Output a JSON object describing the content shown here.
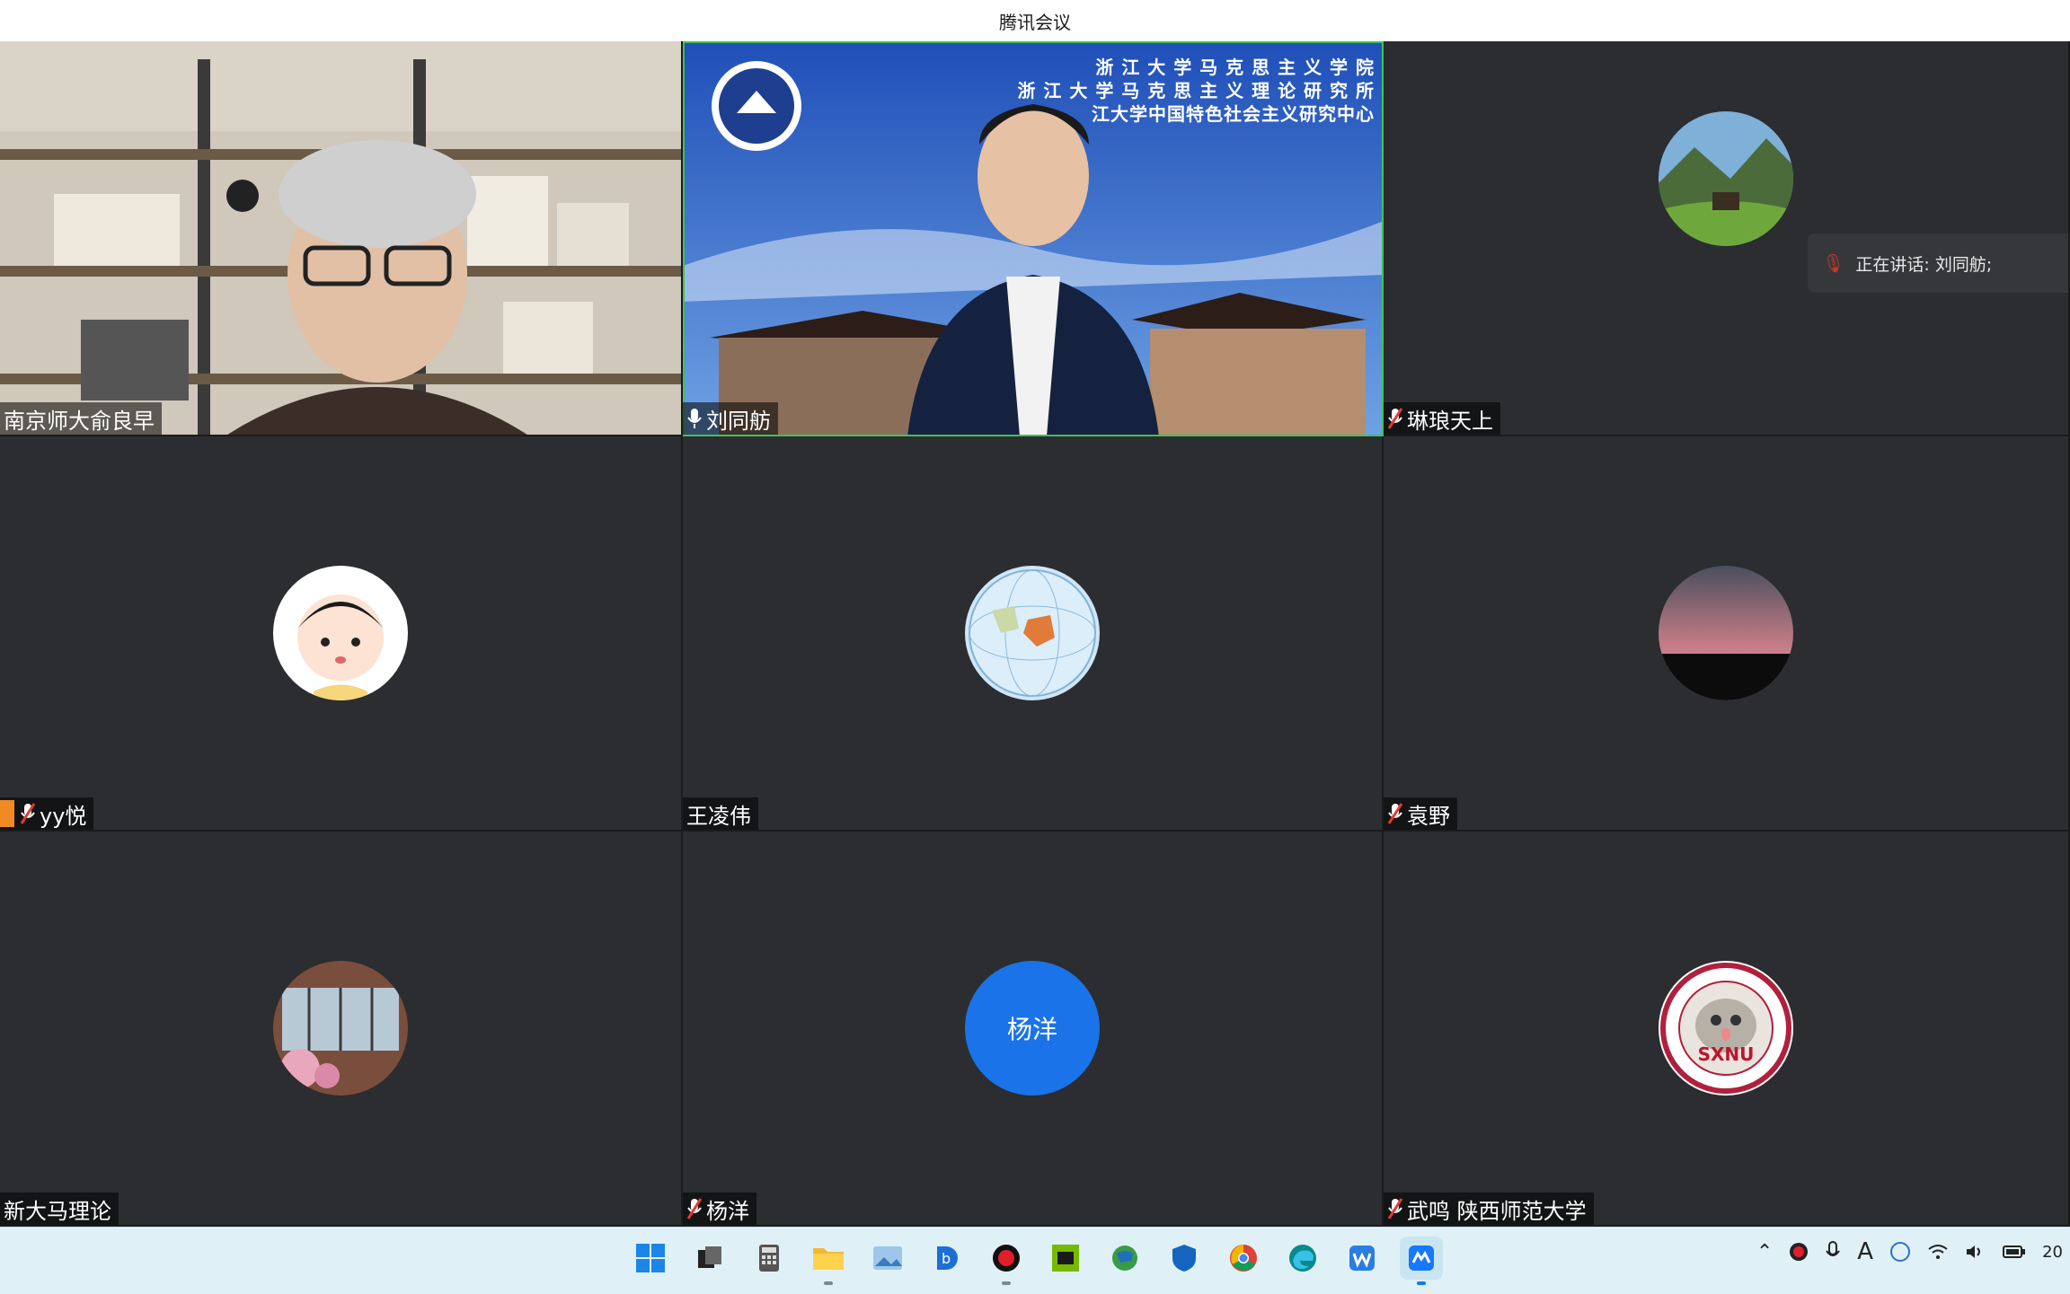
{
  "window": {
    "title": "腾讯会议"
  },
  "participants": [
    {
      "name": "南京师大俞良早",
      "mic": "none",
      "video": "camera-room"
    },
    {
      "name": "刘同舫",
      "mic": "on",
      "video": "camera-zju",
      "background_text": [
        "浙 江 大 学 马 克 思 主 义 学 院",
        "浙 江 大 学 马 克 思 主 义 理 论 研 究 所",
        "江大学中国特色社会主义研究中心"
      ]
    },
    {
      "name": "琳琅天上",
      "mic": "muted",
      "avatar": "landscape-icon"
    },
    {
      "name": "yy悦",
      "mic": "muted",
      "avatar": "cartoon-girl-icon",
      "hand_raised": true
    },
    {
      "name": "王凌伟",
      "mic": "none",
      "avatar": "globe-icon"
    },
    {
      "name": "袁野",
      "mic": "muted",
      "avatar": "sunset-icon"
    },
    {
      "name": "新大马理论",
      "mic": "none",
      "avatar": "building-icon"
    },
    {
      "name": "杨洋",
      "mic": "muted",
      "avatar_text": "杨洋"
    },
    {
      "name": "武鸣 陕西师范大学",
      "mic": "muted",
      "avatar": "sxnu-seal-icon",
      "avatar_text": "SXNU"
    }
  ],
  "speaking": {
    "label": "正在讲话: 刘同舫;"
  },
  "taskbar": {
    "icons": [
      "windows-start-icon",
      "task-view-icon",
      "calculator-icon",
      "file-explorer-icon",
      "image-viewer-icon",
      "b-app-icon",
      "record-icon",
      "nvidia-icon",
      "globe-app-icon",
      "shield-icon",
      "chrome-icon",
      "edge-icon",
      "wps-icon",
      "tencent-meeting-icon"
    ],
    "clock": "20"
  },
  "colors": {
    "speaking_border": "#3ec25b",
    "name_avatar": "#1a73e8",
    "hand": "#f08a24"
  }
}
